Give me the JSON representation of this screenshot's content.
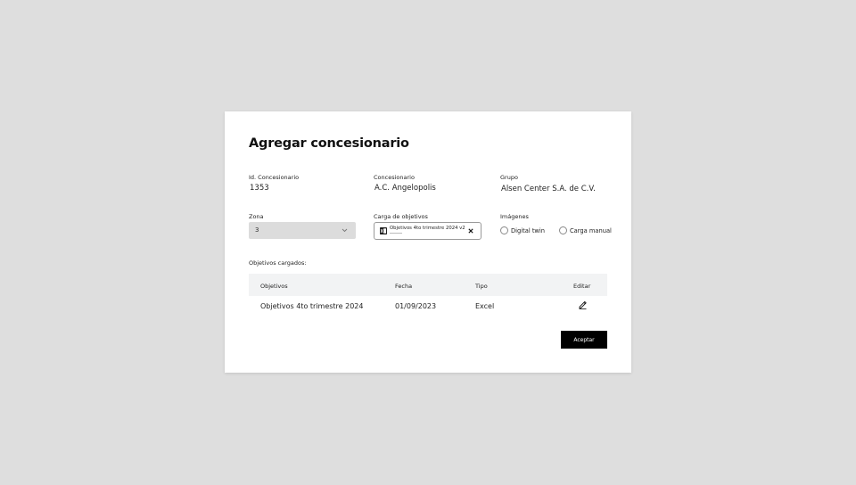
{
  "dialog": {
    "title": "Agregar concesionario",
    "fields": {
      "id_label": "Id. Concesionario",
      "id_value": "1353",
      "dealer_label": "Concesionario",
      "dealer_value": "A.C. Angelopolis",
      "group_label": "Grupo",
      "group_value": "Alsen Center S.A. de C.V."
    },
    "zone": {
      "label": "Zona",
      "selected": "3"
    },
    "upload": {
      "label": "Carga de objetivos",
      "file_name": "Objetivos 4to trimestre 2024 v2"
    },
    "images": {
      "label": "Imágenes",
      "options": [
        "Digital twin",
        "Carga manual"
      ]
    },
    "table": {
      "caption": "Objetivos cargados:",
      "headers": [
        "Objetivos",
        "Fecha",
        "Tipo",
        "Editar"
      ],
      "rows": [
        {
          "objective": "Objetivos 4to trimestre 2024",
          "date": "01/09/2023",
          "type": "Excel"
        }
      ]
    },
    "accept_label": "Aceptar"
  },
  "icons": [
    "chevron-down-icon",
    "excel-file-icon",
    "close-icon",
    "pencil-icon"
  ],
  "colors": {
    "backdrop": "#dedede",
    "primary_button": "#000000",
    "table_header": "#f2f3f4",
    "select_bg": "#dcdcdc"
  }
}
